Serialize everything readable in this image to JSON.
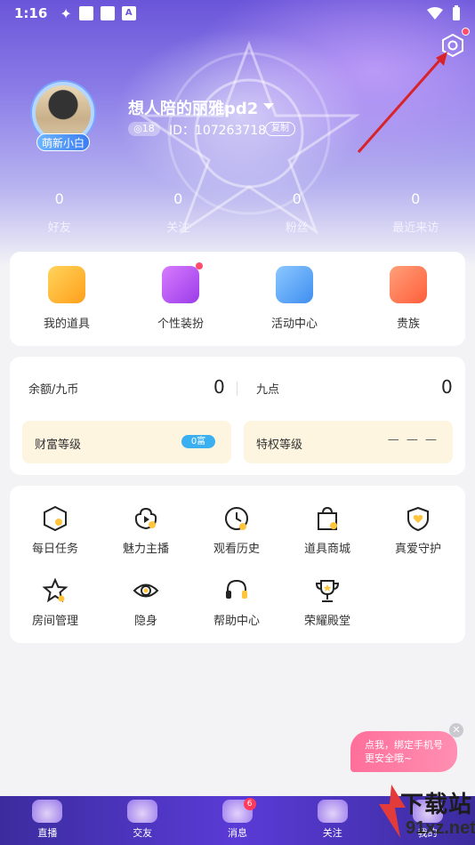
{
  "status_bar": {
    "time": "1:16",
    "notif_icon_letter": "A"
  },
  "profile": {
    "avatar_badge": "萌新小白",
    "username": "想人陪的丽雅pd2",
    "level": "18",
    "id_text": "ID：107263718",
    "copy_label": "复制"
  },
  "stats": [
    {
      "value": "0",
      "label": "好友"
    },
    {
      "value": "0",
      "label": "关注"
    },
    {
      "value": "0",
      "label": "粉丝"
    },
    {
      "value": "0",
      "label": "最近来访"
    }
  ],
  "features": [
    {
      "label": "我的道具",
      "color": "#ffb13b"
    },
    {
      "label": "个性装扮",
      "color": "#b85cf0"
    },
    {
      "label": "活动中心",
      "color": "#5aa8f5"
    },
    {
      "label": "贵族",
      "color": "#ff7a5a"
    }
  ],
  "wallet": {
    "balance_label": "余额/九币",
    "balance_value": "0",
    "points_label": "九点",
    "points_value": "0",
    "wealth_label": "财富等级",
    "wealth_pill": "0富",
    "privilege_label": "特权等级",
    "privilege_value": "— — —"
  },
  "grid": [
    {
      "label": "每日任务",
      "icon": "daily-task-icon"
    },
    {
      "label": "魅力主播",
      "icon": "flower-icon"
    },
    {
      "label": "观看历史",
      "icon": "clock-icon"
    },
    {
      "label": "道具商城",
      "icon": "shopping-bag-icon"
    },
    {
      "label": "真爱守护",
      "icon": "shield-heart-icon"
    },
    {
      "label": "房间管理",
      "icon": "star-icon"
    },
    {
      "label": "隐身",
      "icon": "eye-icon"
    },
    {
      "label": "帮助中心",
      "icon": "headset-icon"
    },
    {
      "label": "荣耀殿堂",
      "icon": "trophy-icon"
    }
  ],
  "bind_tip": {
    "line1": "点我，绑定手机号",
    "line2": "更安全哦~"
  },
  "tabs": [
    {
      "label": "直播"
    },
    {
      "label": "交友"
    },
    {
      "label": "消息",
      "badge": "6"
    },
    {
      "label": "关注"
    },
    {
      "label": "我的"
    }
  ],
  "watermark": {
    "line1": "下载站",
    "line2": "91xz.net"
  }
}
